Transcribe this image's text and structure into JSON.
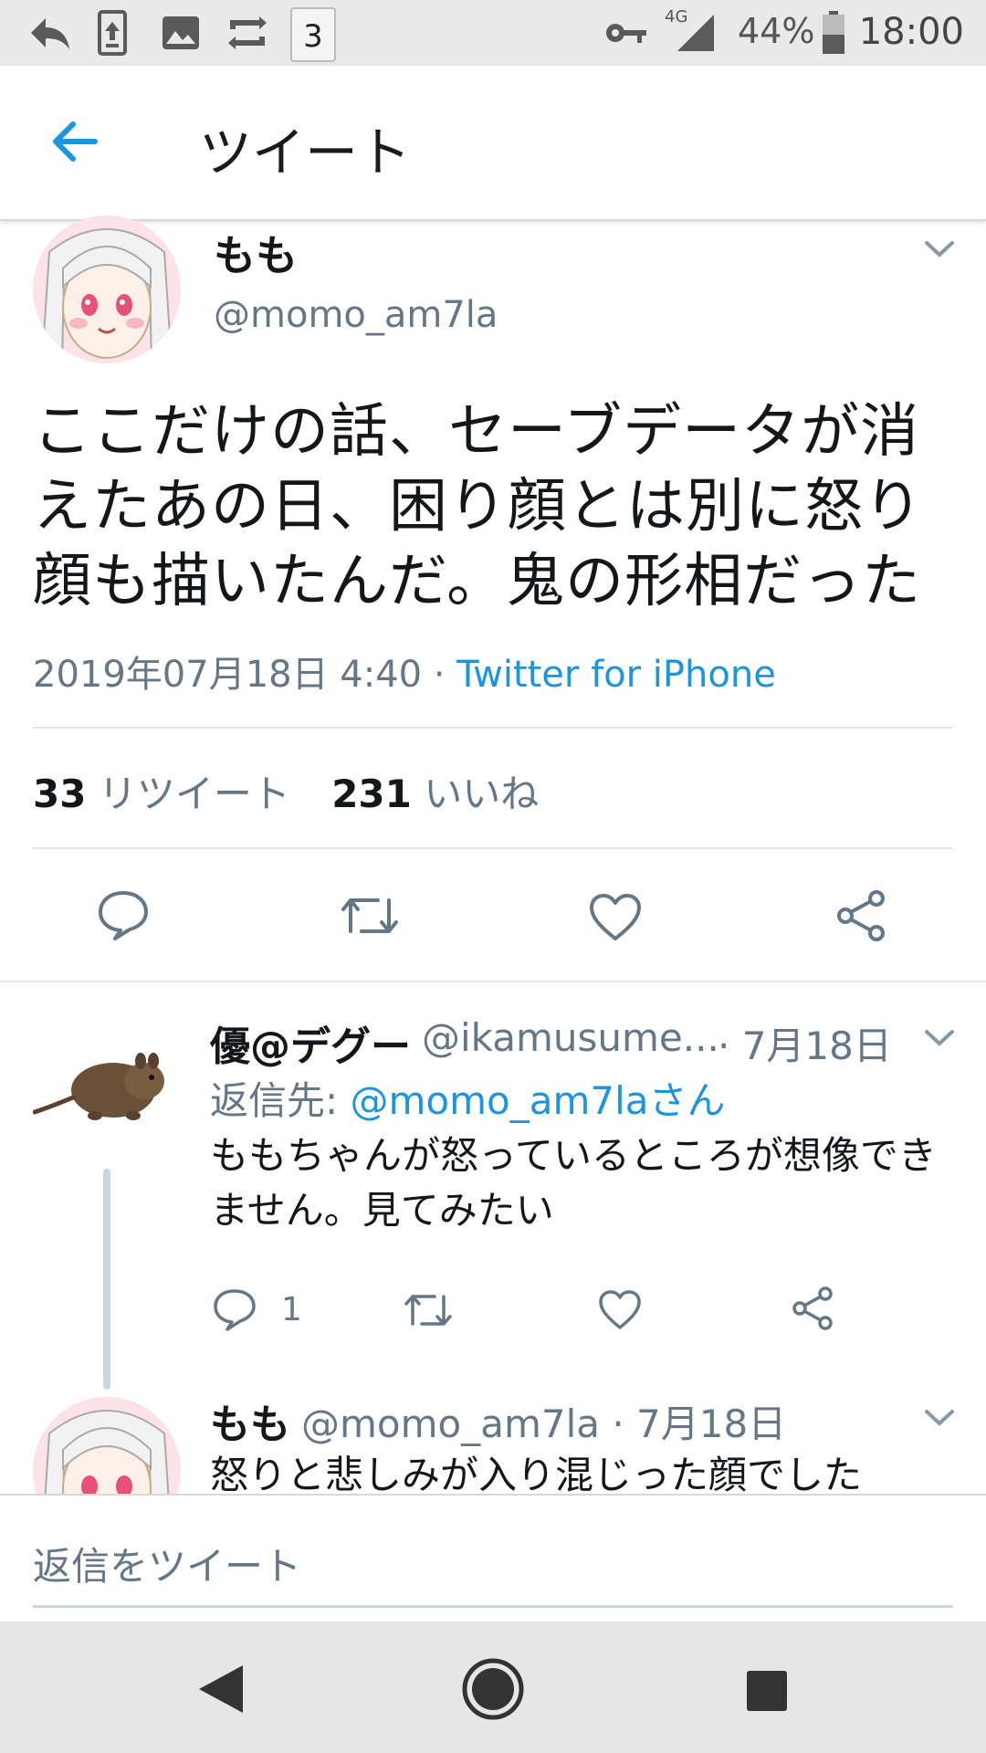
{
  "status_bar": {
    "time": "18:00",
    "battery": "44%",
    "network": "4G",
    "notification_badge": "3"
  },
  "header": {
    "title": "ツイート"
  },
  "tweet": {
    "author_name": "もも",
    "author_handle": "@momo_am7la",
    "text": "ここだけの話、セーブデータが消えたあの日、困り顔とは別に怒り顔も描いたんだ。鬼の形相だった",
    "timestamp": "2019年07月18日 4:40",
    "separator": "·",
    "source": "Twitter for iPhone",
    "retweet_count": "33",
    "retweet_label": "リツイート",
    "like_count": "231",
    "like_label": "いいね"
  },
  "replies": [
    {
      "author_name": "優@デグー",
      "author_handle": "@ikamusume...",
      "date": "· 7月18日",
      "reply_to_prefix": "返信先: ",
      "reply_to_mention": "@momo_am7laさん",
      "text": "ももちゃんが怒っているところが想像できません。見てみたい",
      "reply_count": "1"
    },
    {
      "author_name": "もも",
      "author_handle": "@momo_am7la · 7月18日",
      "text": "怒りと悲しみが入り混じった顔でした"
    }
  ],
  "compose": {
    "placeholder": "返信をツイート"
  },
  "colors": {
    "accent": "#1b95e0",
    "secondary_text": "#657786",
    "primary_text": "#14171a",
    "divider": "#e1e8ed"
  },
  "icons": {
    "status": [
      "reply-icon",
      "upload-icon",
      "image-icon",
      "sync-icon",
      "notification-3-icon",
      "key-icon",
      "signal-icon",
      "battery-icon"
    ],
    "actions": [
      "comment-icon",
      "retweet-icon",
      "heart-icon",
      "share-icon"
    ],
    "nav": [
      "back-triangle-icon",
      "home-circle-icon",
      "recents-square-icon"
    ]
  }
}
